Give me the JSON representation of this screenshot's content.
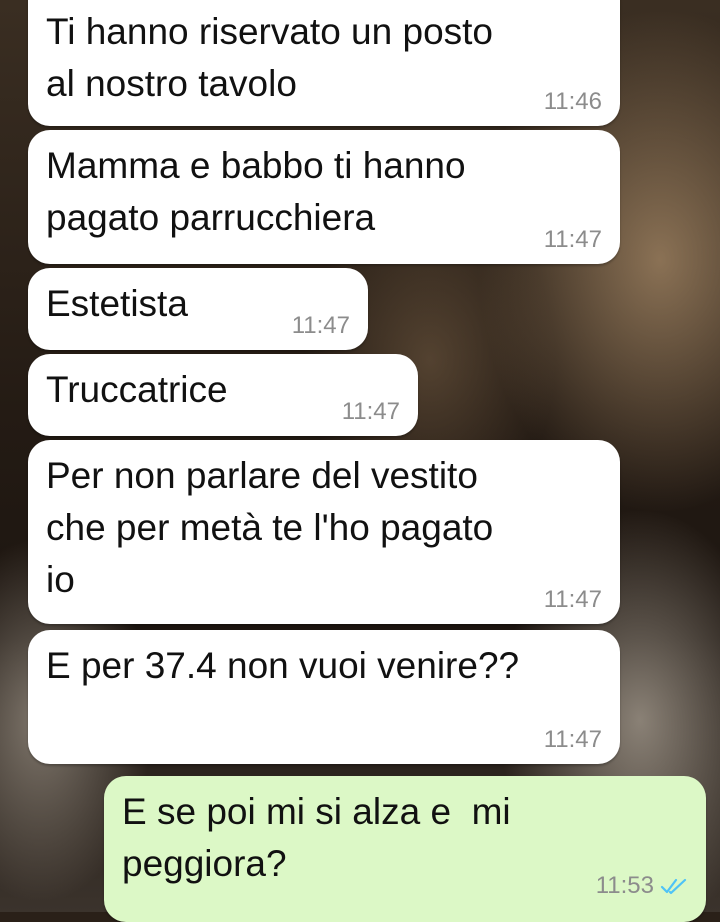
{
  "chat": {
    "messages": [
      {
        "text": "Ti hanno riservato un posto\nal nostro tavolo",
        "time": "11:46",
        "direction": "incoming"
      },
      {
        "text": "Mamma e babbo ti hanno\npagato parrucchiera",
        "time": "11:47",
        "direction": "incoming"
      },
      {
        "text": "Estetista",
        "time": "11:47",
        "direction": "incoming"
      },
      {
        "text": "Truccatrice",
        "time": "11:47",
        "direction": "incoming"
      },
      {
        "text": "Per non parlare del vestito\nche per metà te l'ho pagato\nio",
        "time": "11:47",
        "direction": "incoming"
      },
      {
        "text": "E per 37.4 non vuoi venire??",
        "time": "11:47",
        "direction": "incoming"
      },
      {
        "text": "E se poi mi si alza e  mi\npeggiora?",
        "time": "11:53",
        "direction": "outgoing",
        "status_icon": "double-check-read-icon"
      }
    ]
  },
  "colors": {
    "incoming_bubble": "#ffffff",
    "outgoing_bubble": "#dcf8c6",
    "read_ticks": "#4fc3f7"
  }
}
